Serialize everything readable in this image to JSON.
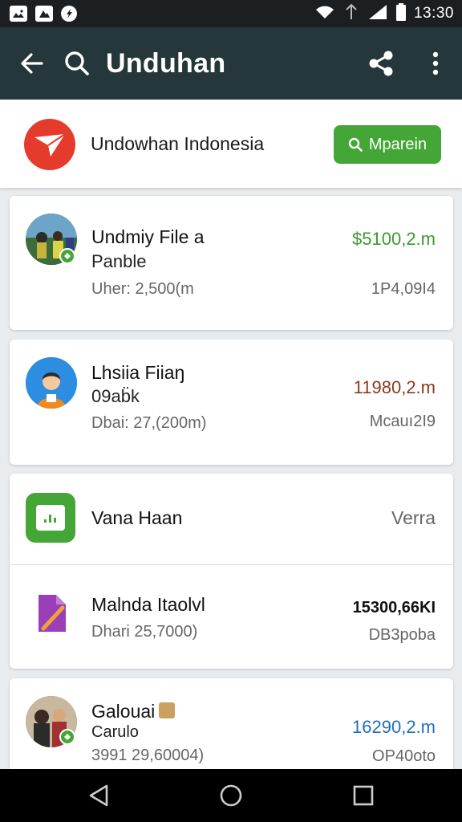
{
  "status_bar": {
    "time": "13:30",
    "left_icons": [
      "image-notification-icon",
      "photo-notification-icon",
      "shazam-notification-icon"
    ],
    "right_icons": [
      "wifi-icon",
      "data-icon",
      "signal-icon",
      "battery-icon"
    ]
  },
  "app_bar": {
    "title": "Unduhan",
    "icons": [
      "back-arrow-icon",
      "search-icon",
      "share-icon",
      "more-vert-icon"
    ]
  },
  "header": {
    "brand_name": "Undowhan Indonesia",
    "button_label": "Mparein",
    "brand_color": "#e53b2c",
    "button_color": "#43a636"
  },
  "items": [
    {
      "title": "Undmiy File a",
      "subtitle": "Panble",
      "meta": "Uher: 2,500(m",
      "amount": "$5100,2.m",
      "meta_right": "1P4,09I4",
      "amount_color": "#3c9a2e"
    },
    {
      "title": "Lhsiia Fiiaŋ",
      "subtitle": "09ab̈k",
      "meta": "Dbai: 27,(200m)",
      "amount": "11980,2.m",
      "meta_right": "Mcauı2I9",
      "amount_color": "#8b3a1c"
    },
    {
      "title": "Vana Haan",
      "meta_right": "Verra"
    },
    {
      "title": "Malnda Itaolvl",
      "meta": "Dhari 25,7000)",
      "amount": "15300,66KI",
      "meta_right": "DB3poba",
      "amount_color": "#111111"
    },
    {
      "title": "Galouai",
      "subtitle": "Carulo",
      "meta": "3991 29,60004)",
      "amount": "16290,2.m",
      "meta_right": "OP40oto",
      "amount_color": "#1f6fbf"
    }
  ],
  "nav_bar": {
    "icons": [
      "back-triangle-icon",
      "home-circle-icon",
      "recents-square-icon"
    ]
  }
}
